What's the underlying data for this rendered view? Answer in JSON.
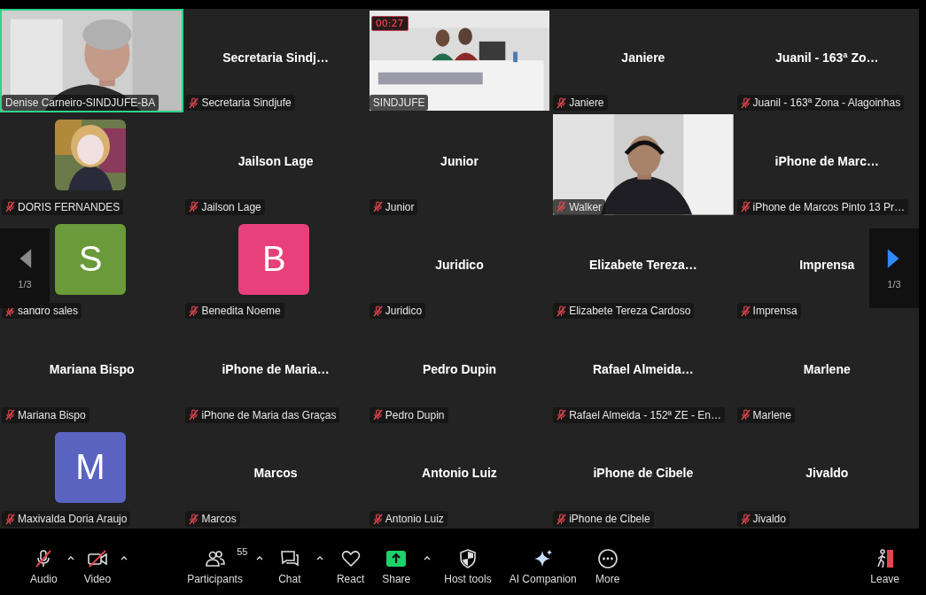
{
  "tiles": [
    {
      "kind": "video",
      "name": "Denise Carneiro-SINDJUFE-BA",
      "muted": false,
      "speaking": true
    },
    {
      "kind": "name",
      "display": "Secretaria Sindj…",
      "name": "Secretaria Sindjufe",
      "muted": true,
      "speaking": false
    },
    {
      "kind": "video",
      "name": "SINDJUFE",
      "muted": false,
      "speaking": false,
      "timer": "00:27"
    },
    {
      "kind": "name",
      "display": "Janiere",
      "name": "Janiere",
      "muted": true,
      "speaking": false
    },
    {
      "kind": "name",
      "display": "Juanil - 163ª Zo…",
      "name": "Juanil - 163ª Zona - Alagoinhas",
      "muted": true,
      "speaking": false
    },
    {
      "name": "DORIS FERNANDES",
      "muted": true,
      "speaking": false
    },
    {
      "kind": "name",
      "display": "Jailson Lage",
      "name": "Jailson Lage",
      "muted": true,
      "speaking": false
    },
    {
      "kind": "name",
      "display": "Junior",
      "name": "Junior",
      "muted": true,
      "speaking": false
    },
    {
      "kind": "video",
      "name": "Walker",
      "muted": true,
      "speaking": false
    },
    {
      "kind": "name",
      "display": "iPhone de Marc…",
      "name": "iPhone de Marcos Pinto 13 Pr…",
      "muted": true,
      "speaking": false
    },
    {
      "kind": "letter",
      "letter": "S",
      "color": "#6a9a3a",
      "name": "sandro sales",
      "muted": true,
      "speaking": false
    },
    {
      "kind": "letter",
      "letter": "B",
      "color": "#e8407a",
      "name": "Benedita Noeme",
      "muted": true,
      "speaking": false
    },
    {
      "kind": "name",
      "display": "Juridico",
      "name": "Juridico",
      "muted": true,
      "speaking": false
    },
    {
      "kind": "name",
      "display": "Elizabete Tereza…",
      "name": "Elizabete Tereza Cardoso",
      "muted": true,
      "speaking": false
    },
    {
      "kind": "name",
      "display": "Imprensa",
      "name": "Imprensa",
      "muted": true,
      "speaking": false
    },
    {
      "kind": "name",
      "display": "Mariana Bispo",
      "name": "Mariana Bispo",
      "muted": true,
      "speaking": false
    },
    {
      "kind": "name",
      "display": "iPhone de Maria…",
      "name": "iPhone de Maria das Graças",
      "muted": true,
      "speaking": false
    },
    {
      "kind": "name",
      "display": "Pedro Dupin",
      "name": "Pedro Dupin",
      "muted": true,
      "speaking": false
    },
    {
      "kind": "name",
      "display": "Rafael Almeida…",
      "name": "Rafael Almeida - 152ª ZE - En…",
      "muted": true,
      "speaking": false
    },
    {
      "kind": "name",
      "display": "Marlene",
      "name": "Marlene",
      "muted": true,
      "speaking": false
    },
    {
      "kind": "letter",
      "letter": "M",
      "color": "#5a64c0",
      "name": "Maxivalda Doria Araujo",
      "muted": true,
      "speaking": false
    },
    {
      "kind": "name",
      "display": "Marcos",
      "name": "Marcos",
      "muted": true,
      "speaking": false
    },
    {
      "kind": "name",
      "display": "Antonio Luiz",
      "name": "Antonio Luiz",
      "muted": true,
      "speaking": false
    },
    {
      "kind": "name",
      "display": "iPhone de Cibele",
      "name": "iPhone de Cibele",
      "muted": true,
      "speaking": false
    },
    {
      "kind": "name",
      "display": "Jivaldo",
      "name": "Jivaldo",
      "muted": true,
      "speaking": false
    }
  ],
  "pager": {
    "prev": {
      "page": "1/3",
      "disabled": true
    },
    "next": {
      "page": "1/3",
      "disabled": false
    }
  },
  "toolbar": [
    {
      "kind": "audio",
      "label": "Audio",
      "off": true,
      "caret": true
    },
    {
      "kind": "video",
      "label": "Video",
      "off": true,
      "caret": true
    },
    {
      "kind": "participants",
      "label": "Participants",
      "count": "55",
      "caret": true
    },
    {
      "kind": "chat",
      "label": "Chat",
      "caret": true
    },
    {
      "kind": "react",
      "label": "React",
      "caret": false
    },
    {
      "kind": "share",
      "label": "Share",
      "caret": true
    },
    {
      "kind": "host",
      "label": "Host tools",
      "caret": false
    },
    {
      "kind": "ai",
      "label": "AI Companion",
      "caret": false
    },
    {
      "kind": "more",
      "label": "More",
      "caret": false
    },
    {
      "kind": "leave",
      "label": "Leave",
      "caret": false
    }
  ]
}
